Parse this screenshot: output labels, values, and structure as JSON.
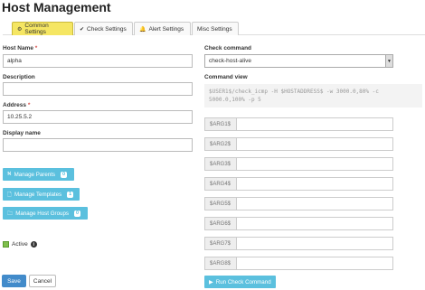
{
  "page": {
    "title": "Host Management"
  },
  "tabs": [
    {
      "label": "Common Settings",
      "icon": "gear-icon",
      "glyph": "⚙"
    },
    {
      "label": "Check Settings",
      "icon": "checkmark-icon",
      "glyph": "✔"
    },
    {
      "label": "Alert Settings",
      "icon": "bell-icon",
      "glyph": "🔔"
    },
    {
      "label": "Misc Settings",
      "icon": "",
      "glyph": ""
    }
  ],
  "form": {
    "host_name": {
      "label": "Host Name",
      "required": "*",
      "value": "alpha"
    },
    "description": {
      "label": "Description",
      "value": ""
    },
    "address": {
      "label": "Address",
      "required": "*",
      "value": "10.25.5.2"
    },
    "display_name": {
      "label": "Display name",
      "value": ""
    }
  },
  "buttons": {
    "manage_parents": {
      "label": "Manage Parents",
      "count": "0",
      "icon": "sitemap-icon",
      "glyph": "⛕"
    },
    "manage_templates": {
      "label": "Manage Templates",
      "count": "1",
      "icon": "file-icon",
      "glyph": "🗋"
    },
    "manage_host_groups": {
      "label": "Manage Host Groups",
      "count": "0",
      "icon": "folder-icon",
      "glyph": "🗀"
    },
    "run_check": {
      "label": "Run Check Command",
      "icon": "play-icon",
      "glyph": "▶"
    },
    "save": "Save",
    "cancel": "Cancel"
  },
  "active": {
    "label": "Active",
    "checked": true
  },
  "check": {
    "label": "Check command",
    "selected": "check-host-alive",
    "command_view_label": "Command view",
    "command_text": "$USER1$/check_icmp -H $HOSTADDRESS$ -w 3000.0,80% -c 5000.0,100% -p 5"
  },
  "args": [
    "$ARG1$",
    "$ARG2$",
    "$ARG3$",
    "$ARG4$",
    "$ARG5$",
    "$ARG6$",
    "$ARG7$",
    "$ARG8$"
  ],
  "colors": {
    "active_tab": "#f5e663",
    "info_button": "#5bc0de",
    "primary": "#428bca",
    "required": "#d9534f"
  }
}
